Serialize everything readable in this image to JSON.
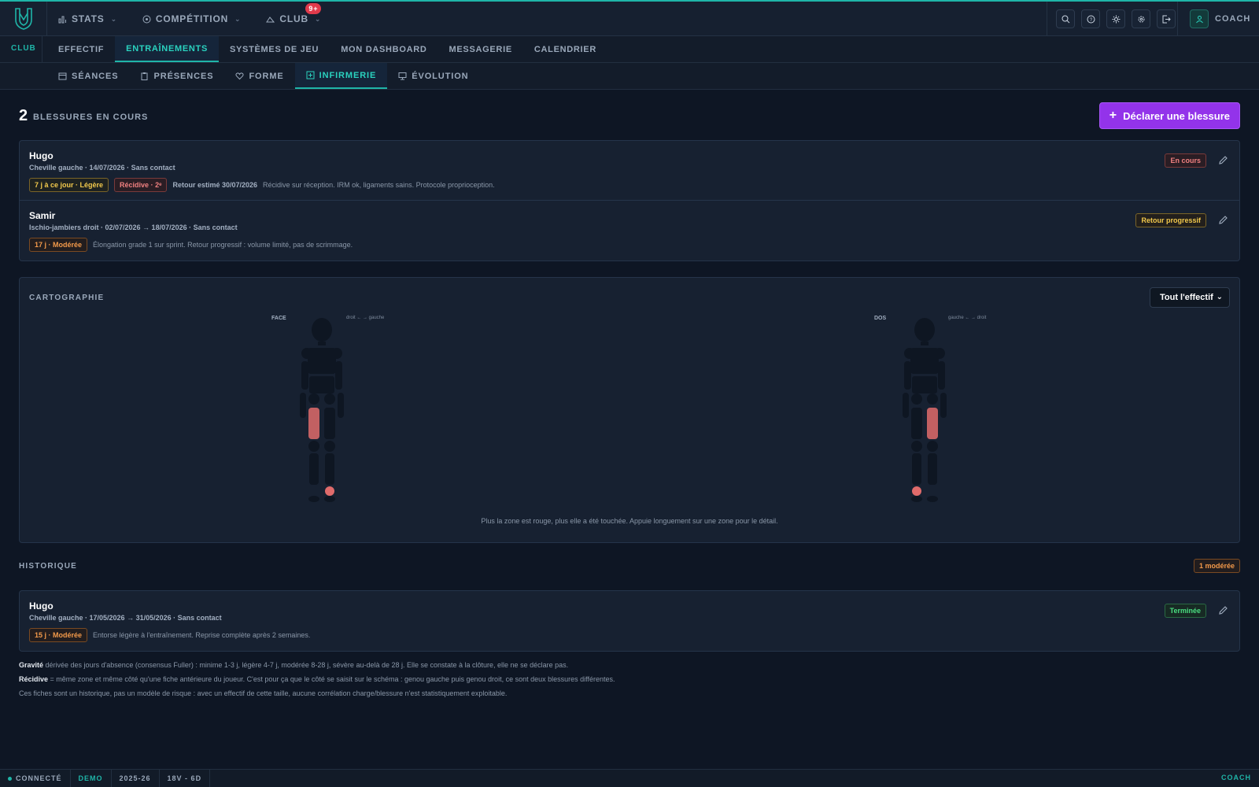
{
  "brand": {
    "logo": "shield-logo"
  },
  "topnav": {
    "items": [
      {
        "label": "STATS",
        "icon": "bar-chart-icon"
      },
      {
        "label": "COMPÉTITION",
        "icon": "target-icon"
      },
      {
        "label": "CLUB",
        "icon": "whistle-icon",
        "badge": "9+"
      }
    ],
    "icons": [
      "search-icon",
      "help-icon",
      "sun-icon",
      "gear-icon",
      "logout-icon"
    ],
    "user": "COACH"
  },
  "secnav": {
    "section": "CLUB",
    "tabs": [
      "EFFECTIF",
      "ENTRAÎNEMENTS",
      "SYSTÈMES DE JEU",
      "MON DASHBOARD",
      "MESSAGERIE",
      "CALENDRIER"
    ],
    "active": "ENTRAÎNEMENTS"
  },
  "subnav": {
    "tabs": [
      "SÉANCES",
      "PRÉSENCES",
      "FORME",
      "INFIRMERIE",
      "ÉVOLUTION"
    ],
    "active": "INFIRMERIE"
  },
  "summary": {
    "count": "2",
    "label": "BLESSURES EN COURS",
    "declare_button": "Déclarer une blessure"
  },
  "current_injuries": [
    {
      "name": "Hugo",
      "meta": "Cheville gauche · 14/07/2026 · Sans contact",
      "severity": "7 j à ce jour · Légère",
      "recidive": "Récidive · 2ᵉ",
      "return": "Retour estimé 30/07/2026",
      "note": "Récidive sur réception. IRM ok, ligaments sains. Protocole proprioception.",
      "status": "En cours"
    },
    {
      "name": "Samir",
      "meta": "Ischio-jambiers droit · 02/07/2026 → 18/07/2026 · Sans contact",
      "severity": "17 j · Modérée",
      "note": "Élongation grade 1 sur sprint. Retour progressif : volume limité, pas de scrimmage.",
      "status": "Retour progressif"
    }
  ],
  "cartography": {
    "title": "CARTOGRAPHIE",
    "filter": "Tout l'effectif",
    "front_label": "FACE",
    "front_dir": "droit ← → gauche",
    "back_label": "DOS",
    "back_dir": "gauche ← → droit",
    "caption": "Plus la zone est rouge, plus elle a été touchée. Appuie longuement sur une zone pour le détail.",
    "highlight_color": "#e06b6b"
  },
  "history": {
    "title": "HISTORIQUE",
    "badge": "1 modérée",
    "items": [
      {
        "name": "Hugo",
        "meta": "Cheville gauche · 17/05/2026 → 31/05/2026 · Sans contact",
        "severity": "15 j · Modérée",
        "note": "Entorse légère à l'entraînement. Reprise complète après 2 semaines.",
        "status": "Terminée"
      }
    ]
  },
  "notes": {
    "gravite_bold": "Gravité",
    "gravite_text": " dérivée des jours d'absence (consensus Fuller) : minime 1-3 j, légère 4-7 j, modérée 8-28 j, sévère au-delà de 28 j. Elle se constate à la clôture, elle ne se déclare pas.",
    "recidive_bold": "Récidive",
    "recidive_text": " = même zone et même côté qu'une fiche antérieure du joueur. C'est pour ça que le côté se saisit sur le schéma : genou gauche puis genou droit, ce sont deux blessures différentes.",
    "historique_text": "Ces fiches sont un historique, pas un modèle de risque : avec un effectif de cette taille, aucune corrélation charge/blessure n'est statistiquement exploitable."
  },
  "statusbar": {
    "connected": "CONNECTÉ",
    "demo": "DEMO",
    "season": "2025-26",
    "record": "18V - 6D",
    "role": "COACH"
  },
  "colors": {
    "accent": "#1fb5a8",
    "primary_button": "#9333ea",
    "background": "#0e1624"
  }
}
